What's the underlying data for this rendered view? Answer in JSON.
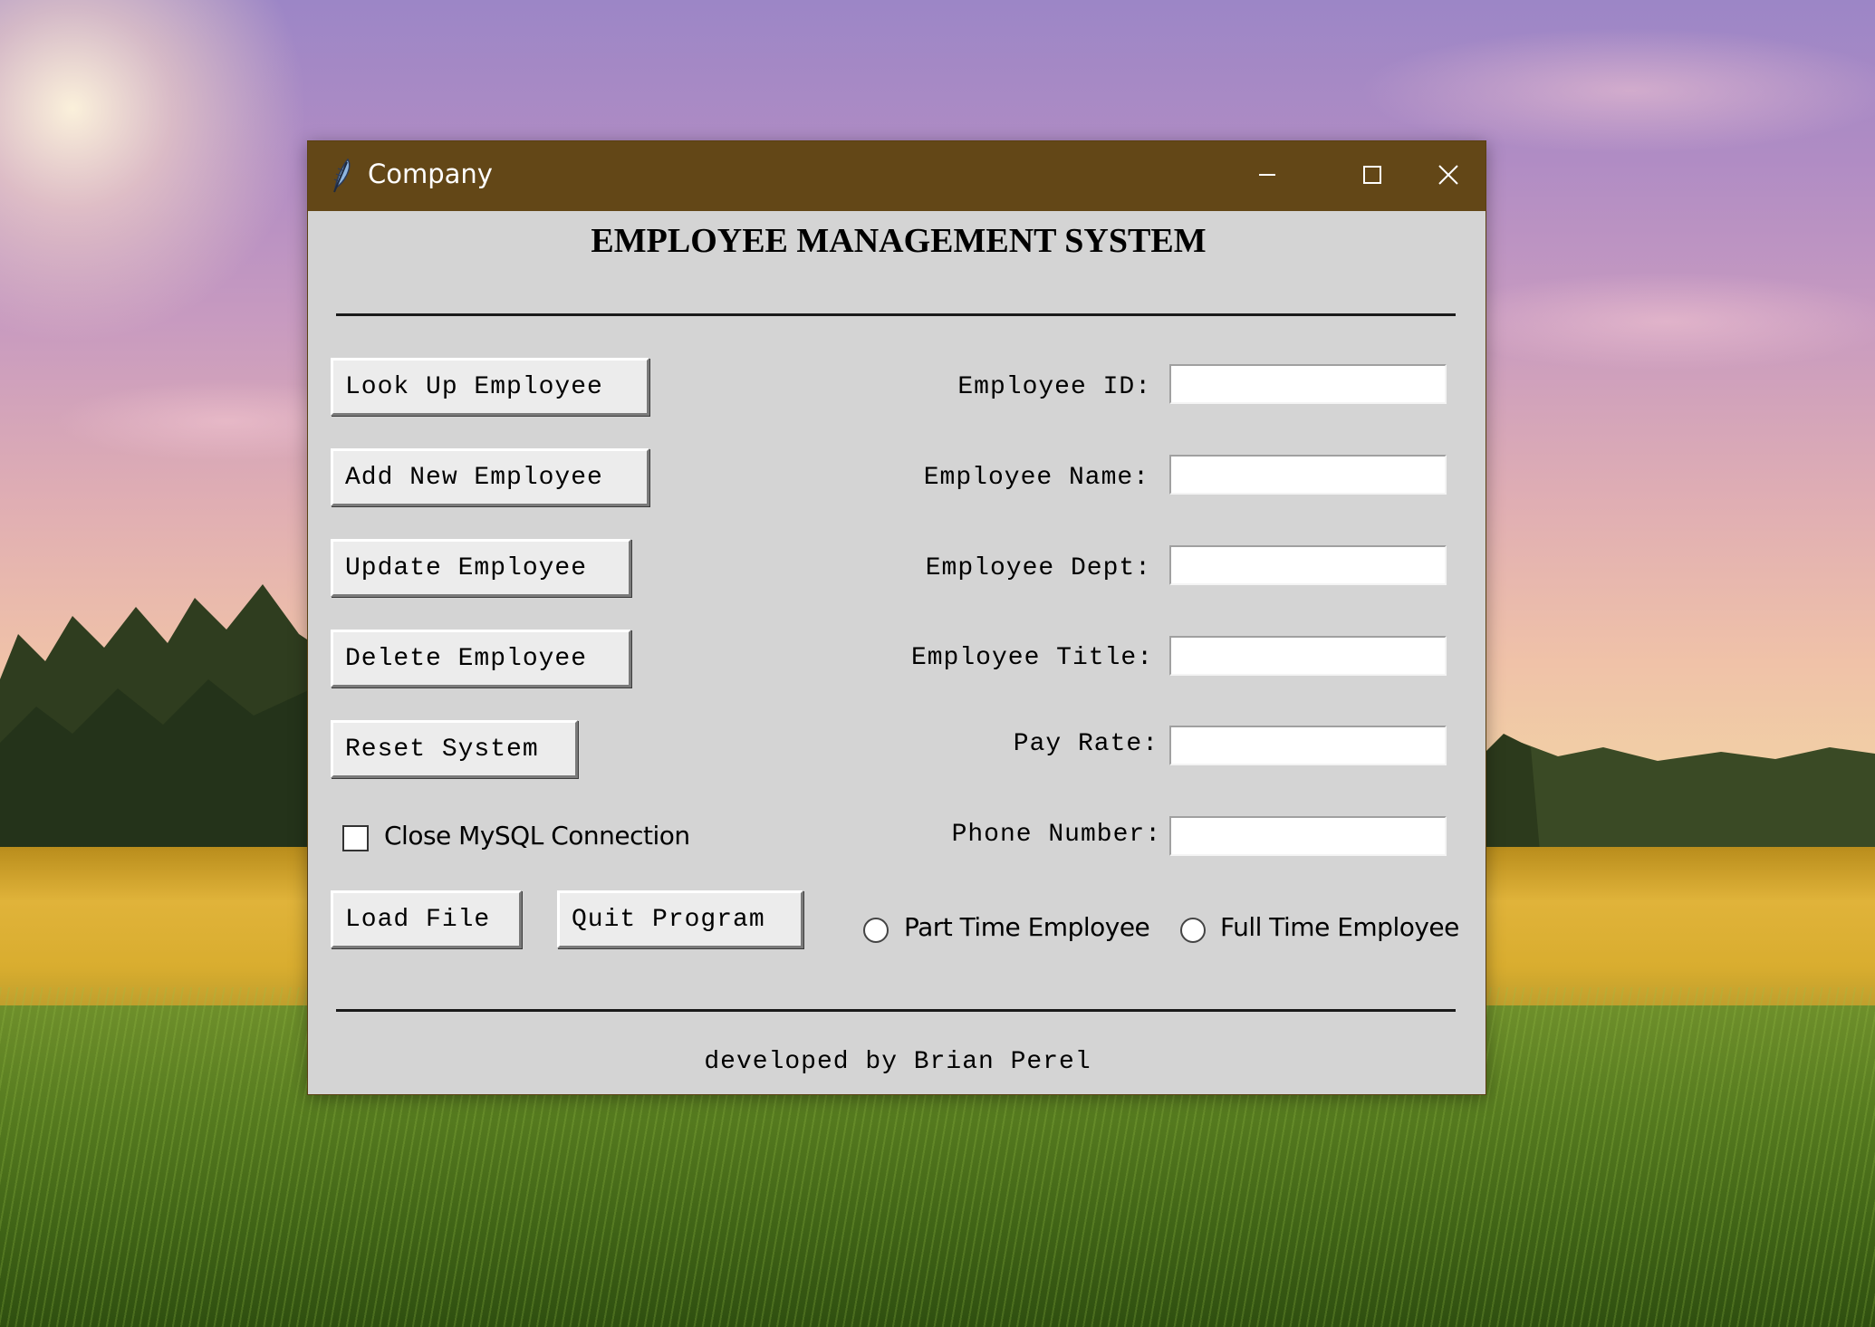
{
  "window": {
    "title": "Company",
    "titlebar_color": "#634717",
    "background_color": "#d4d4d4"
  },
  "main": {
    "heading": "EMPLOYEE MANAGEMENT SYSTEM",
    "buttons": {
      "look_up": "Look Up Employee",
      "add_new": "Add New Employee",
      "update": "Update Employee",
      "delete": "Delete Employee",
      "reset": "Reset System",
      "load_file": "Load File",
      "quit": "Quit Program"
    },
    "fields": [
      {
        "label": "Employee ID:",
        "value": ""
      },
      {
        "label": "Employee Name:",
        "value": ""
      },
      {
        "label": "Employee Dept:",
        "value": ""
      },
      {
        "label": "Employee Title:",
        "value": ""
      },
      {
        "label": "Pay Rate:",
        "value": ""
      },
      {
        "label": "Phone Number:",
        "value": ""
      }
    ],
    "checkbox": {
      "label": "Close MySQL Connection",
      "checked": false
    },
    "radios": [
      {
        "label": "Part Time Employee",
        "selected": false
      },
      {
        "label": "Full Time Employee",
        "selected": false
      }
    ],
    "footer": "developed by Brian Perel"
  },
  "icons": {
    "app": "feather-icon",
    "minimize": "minimize-icon",
    "maximize": "maximize-icon",
    "close": "close-icon"
  }
}
